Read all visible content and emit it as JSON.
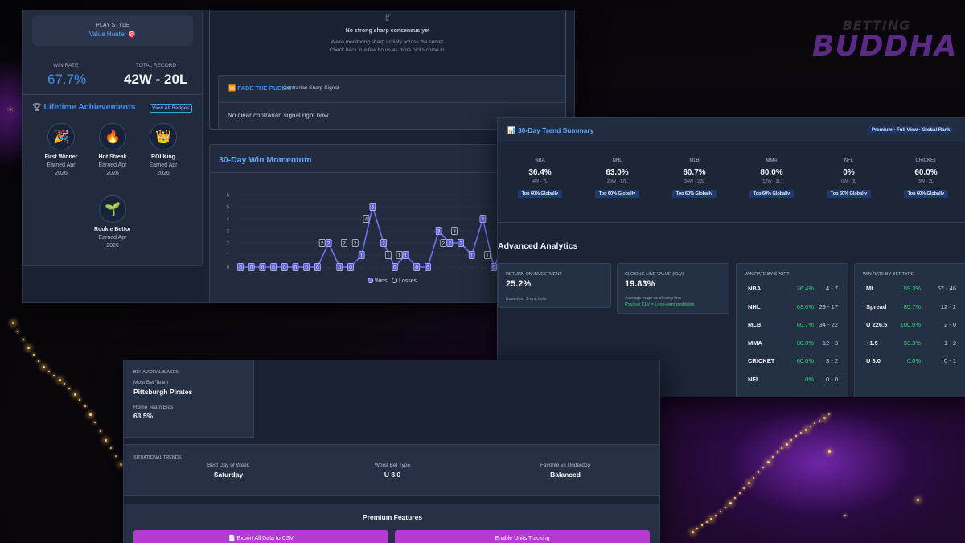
{
  "brand": {
    "top": "BETTING",
    "bottom": "BUDDHA"
  },
  "profile": {
    "play_style_label": "PLAY STYLE",
    "play_style_value": "Value Hunter 🎯",
    "win_rate_label": "WIN RATE",
    "win_rate": "67.7%",
    "record_label": "TOTAL RECORD",
    "record": "42W - 20L"
  },
  "achievements": {
    "title": "Lifetime Achievements",
    "view_all": "View All Badges",
    "badges": [
      {
        "icon": "party-popper-icon",
        "glyph": "🎉",
        "name": "First Winner",
        "earned_1": "Earned Apr",
        "earned_2": "2026"
      },
      {
        "icon": "flame-icon",
        "glyph": "🔥",
        "name": "Hot Streak",
        "earned_1": "Earned Apr",
        "earned_2": "2026"
      },
      {
        "icon": "crown-icon",
        "glyph": "👑",
        "name": "ROI King",
        "earned_1": "Earned Apr",
        "earned_2": "2026"
      },
      {
        "icon": "seedling-icon",
        "glyph": "🌱",
        "name": "Rookie Bettor",
        "earned_1": "Earned Apr",
        "earned_2": "2026"
      }
    ]
  },
  "sharp": {
    "title": "No strong sharp consensus yet",
    "line1": "We're monitoring sharp activity across the server.",
    "line2": "Check back in a few hours as more picks come in.",
    "fade_title": "🆚 FADE THE PUBLIC",
    "fade_sub": "Contrarian Sharp Signal",
    "fade_msg": "No clear contrarian signal right now"
  },
  "momentum": {
    "title": "30-Day Win Momentum",
    "legend_wins": "Wins",
    "legend_losses": "Losses",
    "colors": {
      "wins": "#6e6ff0",
      "losses": "#cfd5df"
    }
  },
  "chart_data": {
    "type": "line",
    "title": "30-Day Win Momentum",
    "ylim": [
      0,
      6
    ],
    "y_ticks": [
      "0",
      "1",
      "2",
      "3",
      "4",
      "5",
      "6"
    ],
    "series": [
      {
        "name": "Wins",
        "values": [
          0,
          0,
          0,
          0,
          0,
          0,
          0,
          0,
          2,
          0,
          0,
          1,
          5,
          2,
          0,
          1,
          0,
          0,
          3,
          2,
          2,
          1,
          4,
          0,
          2
        ]
      },
      {
        "name": "Losses",
        "values": [
          0,
          0,
          0,
          0,
          0,
          0,
          0,
          0,
          2,
          0,
          2,
          2,
          4,
          0,
          1,
          1,
          0,
          0,
          0,
          2,
          3,
          0,
          0,
          1,
          0
        ]
      }
    ]
  },
  "trend": {
    "title": "📊 30-Day Trend Summary",
    "premium": "Premium • Full View • Global Rank",
    "sports": [
      {
        "name": "NBA",
        "pct": "36.4%",
        "record": "4W - 7L",
        "rank": "Top 60% Globally"
      },
      {
        "name": "NHL",
        "pct": "63.0%",
        "record": "29W - 17L",
        "rank": "Top 60% Globally"
      },
      {
        "name": "MLB",
        "pct": "60.7%",
        "record": "34W - 22L",
        "rank": "Top 60% Globally"
      },
      {
        "name": "MMA",
        "pct": "80.0%",
        "record": "12W - 3L",
        "rank": "Top 60% Globally"
      },
      {
        "name": "NFL",
        "pct": "0%",
        "record": "0W - 0L",
        "rank": "Top 60% Globally"
      },
      {
        "name": "CRICKET",
        "pct": "60.0%",
        "record": "3W - 2L",
        "rank": "Top 60% Globally"
      }
    ]
  },
  "analytics": {
    "title": "Advanced Analytics",
    "roi_label": "RETURN ON INVESTMENT",
    "roi_value": "25.2%",
    "roi_sub": "Based on 1-unit bets",
    "clv_label": "CLOSING LINE VALUE (CLV)",
    "clv_value": "19.83%",
    "clv_sub": "Average edge vs closing line",
    "clv_note": "Positive CLV = Long-term profitable",
    "by_sport_title": "WIN RATE BY SPORT",
    "by_sport": [
      {
        "k": "NBA",
        "pct": "36.4%",
        "rec": "4 - 7"
      },
      {
        "k": "NHL",
        "pct": "63.0%",
        "rec": "29 - 17"
      },
      {
        "k": "MLB",
        "pct": "60.7%",
        "rec": "34 - 22"
      },
      {
        "k": "MMA",
        "pct": "80.0%",
        "rec": "12 - 3"
      },
      {
        "k": "CRICKET",
        "pct": "60.0%",
        "rec": "3 - 2"
      },
      {
        "k": "NFL",
        "pct": "0%",
        "rec": "0 - 0"
      }
    ],
    "by_type_title": "WIN RATE BY BET TYPE",
    "by_type": [
      {
        "k": "ML",
        "pct": "59.3%",
        "rec": "67 - 46"
      },
      {
        "k": "Spread",
        "pct": "85.7%",
        "rec": "12 - 2"
      },
      {
        "k": "U 226.5",
        "pct": "100.0%",
        "rec": "2 - 0"
      },
      {
        "k": "+1.5",
        "pct": "33.3%",
        "rec": "1 - 2"
      },
      {
        "k": "U 8.0",
        "pct": "0.0%",
        "rec": "0 - 1"
      }
    ]
  },
  "behavior": {
    "title": "BEHAVIORAL BIASES",
    "most_bet_label": "Most Bet Team",
    "most_bet_value": "Pittsburgh Pirates",
    "home_bias_label": "Home Team Bias",
    "home_bias_value": "63.5%"
  },
  "situational": {
    "title": "SITUATIONAL TRENDS",
    "items": [
      {
        "label": "Best Day of Week",
        "value": "Saturday"
      },
      {
        "label": "Worst Bet Type",
        "value": "U 8.0"
      },
      {
        "label": "Favorite vs Underdog",
        "value": "Balanced"
      }
    ]
  },
  "premium": {
    "title": "Premium Features",
    "export": "📄 Export All Data to CSV",
    "units": "Enable Units Tracking"
  }
}
